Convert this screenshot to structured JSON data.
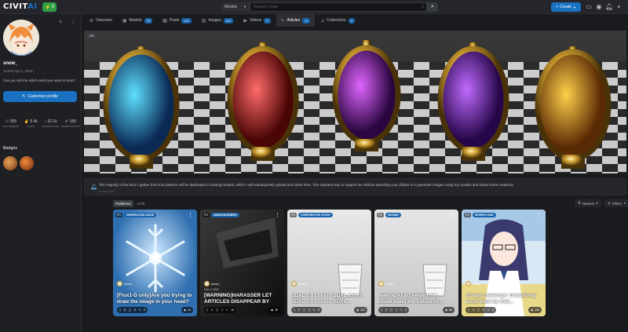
{
  "topbar": {
    "logo_text": "CIVIT",
    "logo_accent": "AI",
    "buzz_count": "0",
    "search_scope": "Models",
    "search_placeholder": "Search Civitai",
    "search_shortcut": "/",
    "create_label": "Create"
  },
  "profile": {
    "username": "snow_",
    "joined": "Joined Apr 1, 2023",
    "bio": "Can you tell me which artist you want to train?",
    "customize_label": "Customize profile",
    "stats": [
      {
        "value": "395",
        "label": "FOLLOWERS"
      },
      {
        "value": "8.4k",
        "label": "LIKES"
      },
      {
        "value": "62.1k",
        "label": "DOWNLOADS"
      },
      {
        "value": "189",
        "label": "GENERATIONS"
      }
    ],
    "badges_title": "Badges"
  },
  "tabs": [
    {
      "label": "Overview",
      "count": ""
    },
    {
      "label": "Models",
      "count": "78"
    },
    {
      "label": "Posts",
      "count": "113"
    },
    {
      "label": "Images",
      "count": "617"
    },
    {
      "label": "Videos",
      "count": "0"
    },
    {
      "label": "Articles",
      "count": "11"
    },
    {
      "label": "Collections",
      "count": "0"
    }
  ],
  "banner": {
    "badge": "PG"
  },
  "notice": {
    "message": "The majority of the buzz I gather from this platform will be dedicated to training models, which I will subsequently upload and share here. The simplest way to support me without spending your dollars is to generate images using my models and share those creations.",
    "time": "5 days ago"
  },
  "filters": {
    "published": "Published",
    "draft": "Draft",
    "sort": "Newest",
    "filters": "Filters"
  },
  "articles": [
    {
      "tag": "GENERATION GUIDE",
      "badge": "PG",
      "author": "snow_",
      "date": "",
      "title": "[Flux1-D only]Are you trying to draw the image in your head?",
      "likes": "8",
      "comments": "0",
      "tips": "0",
      "views": "14"
    },
    {
      "tag": "ANNOUNCEMENT",
      "badge": "PG",
      "author": "snow_",
      "date": "Feb 4, 2025",
      "title": "[WARNING]HARASSER LET ARTICLES DISAPPEAR BY ABU...",
      "likes": "0",
      "comments": "1",
      "tips": "16",
      "views": "28"
    },
    {
      "tag": "COMPARATIVE STUDY",
      "badge": "PG",
      "author": "snow_",
      "date": "",
      "title": "SDXL 0.9 Lora in SDXL 1.0 vs SDXL 1.0 Lora in SDXL...",
      "likes": "0",
      "comments": "0",
      "tips": "0",
      "views": "147"
    },
    {
      "tag": "MUSING",
      "badge": "PG",
      "author": "snow_",
      "date": "",
      "title": "Making AI art helped me understand the nature of...",
      "likes": "0",
      "comments": "1",
      "tips": "0",
      "views": "88"
    },
    {
      "tag": "WORKFLOWS",
      "badge": "PG",
      "author": "snow_",
      "date": "",
      "title": "10 day challenge: Grounding artist style by trial...",
      "likes": "4",
      "comments": "0",
      "tips": "0",
      "views": "133"
    }
  ]
}
